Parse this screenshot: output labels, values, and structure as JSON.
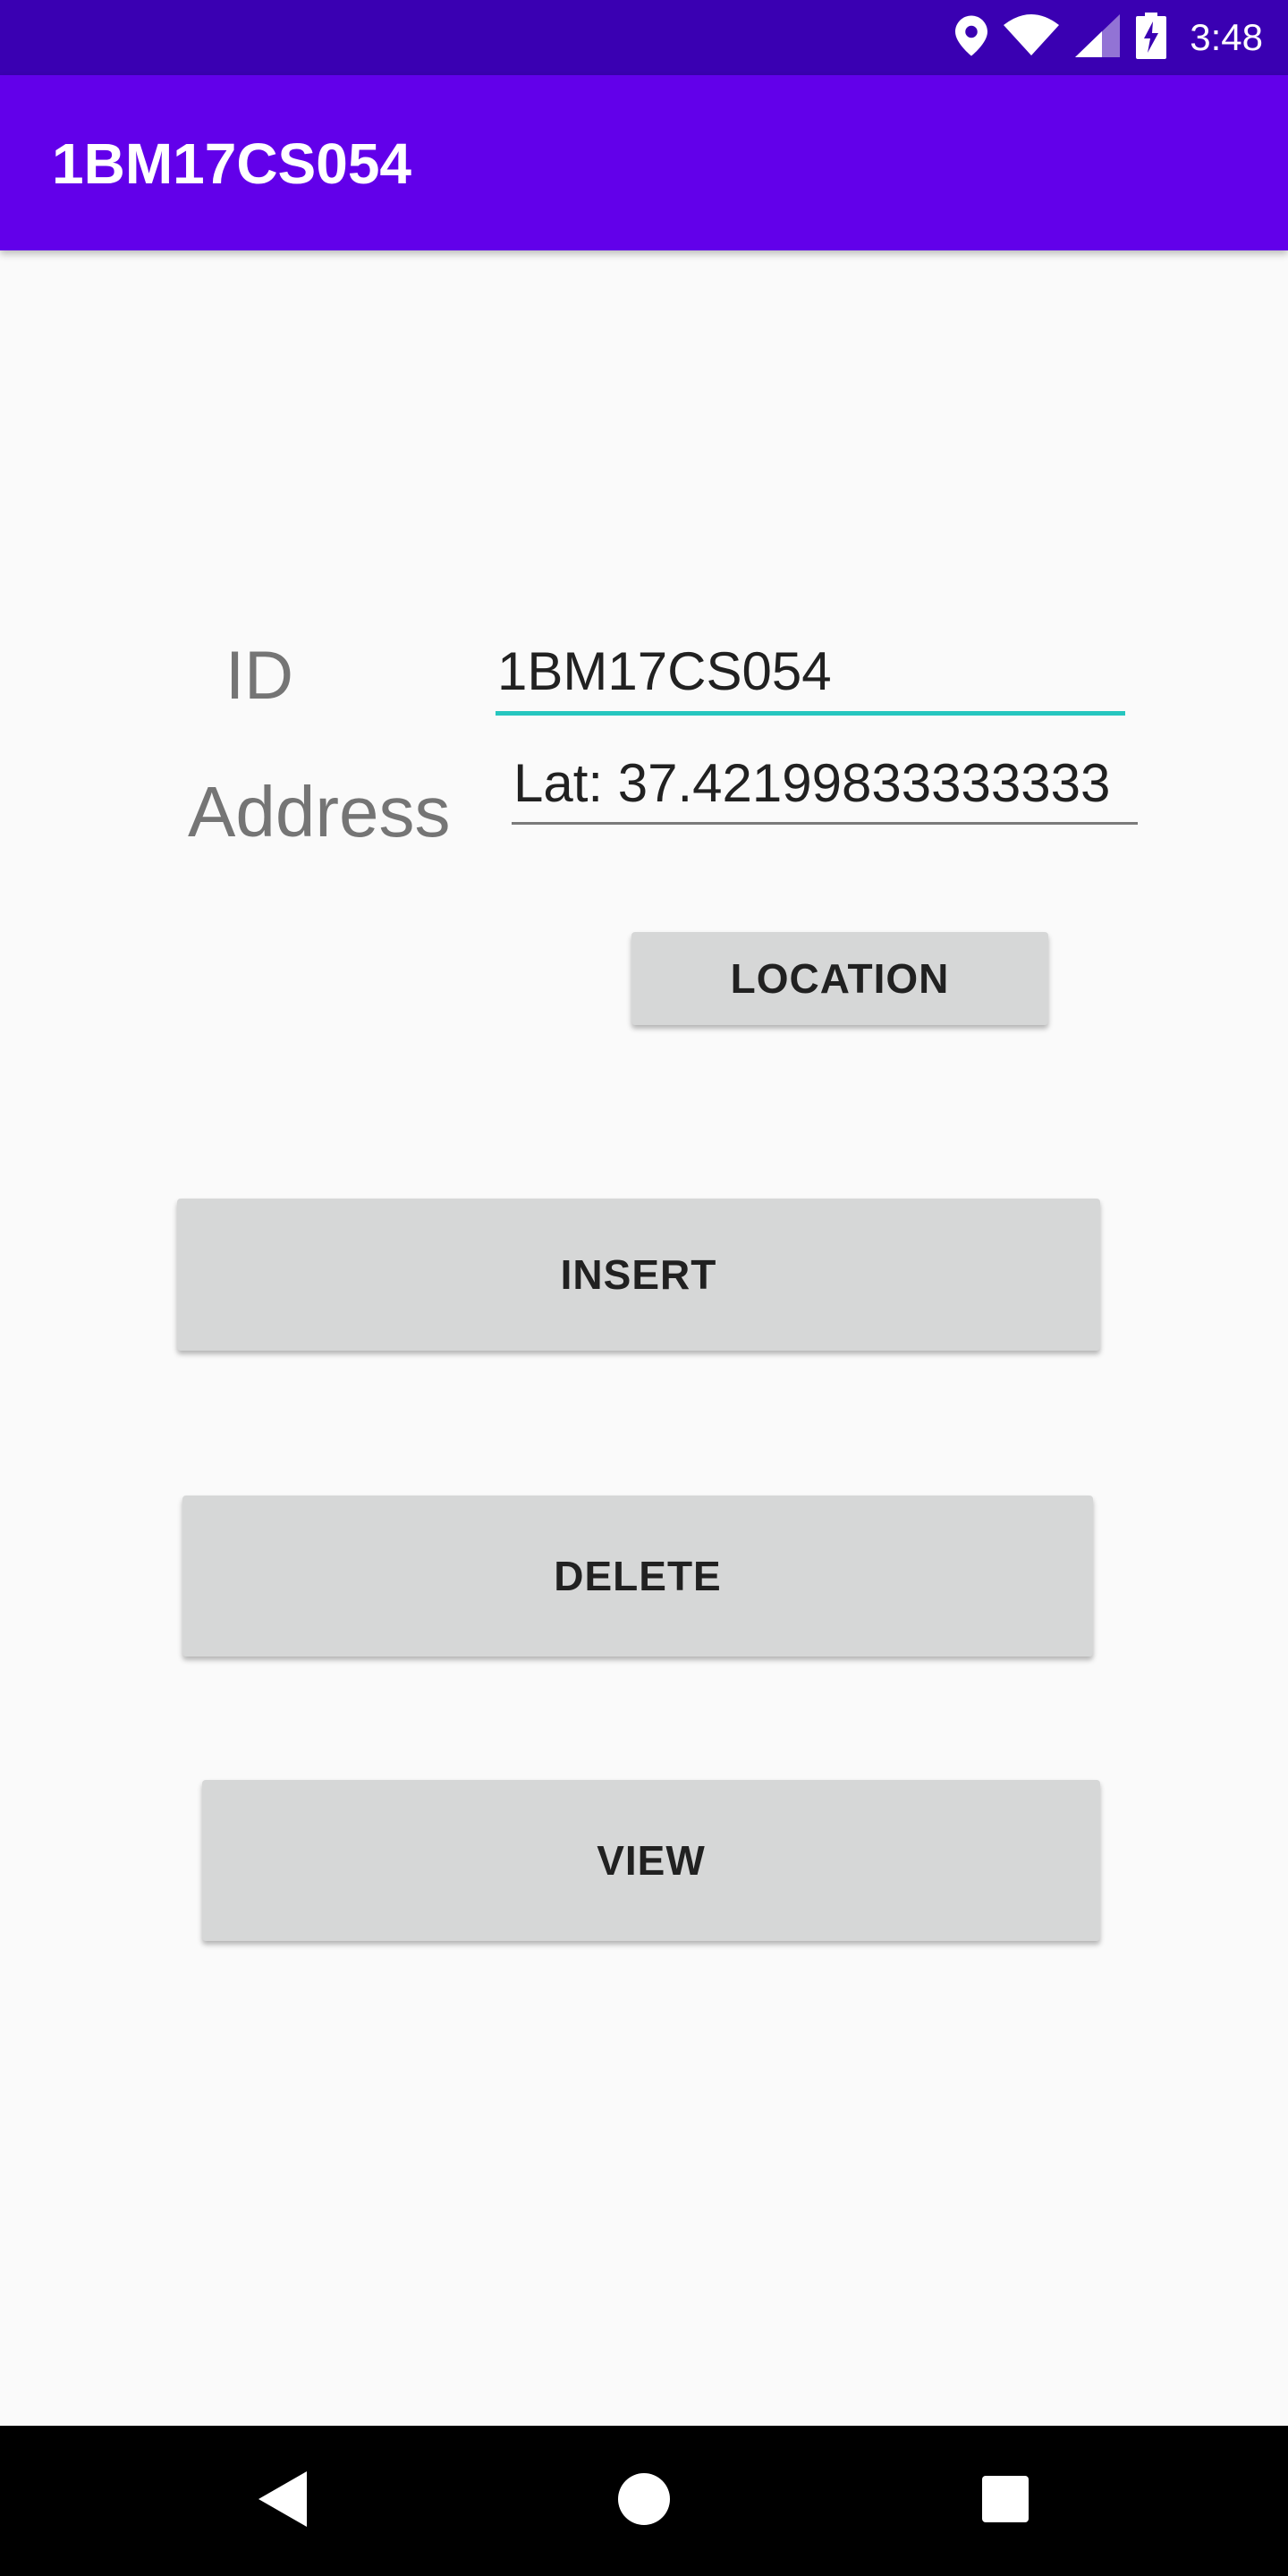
{
  "status_bar": {
    "time": "3:48",
    "icons": [
      "location-pin-icon",
      "wifi-icon",
      "cell-signal-icon",
      "battery-charging-icon"
    ]
  },
  "app_bar": {
    "title": "1BM17CS054"
  },
  "form": {
    "id_label": "ID",
    "id_value": "1BM17CS054",
    "address_label": "Address",
    "address_value": "Lat: 37.42199833333333"
  },
  "buttons": {
    "location": "LOCATION",
    "insert": "INSERT",
    "delete": "DELETE",
    "view": "VIEW"
  },
  "nav_bar": {
    "icons": [
      "back-icon",
      "home-icon",
      "recents-icon"
    ]
  },
  "colors": {
    "status_bar": "#3a00b2",
    "app_bar": "#6200ea",
    "accent_underline": "#26c6bf",
    "button_bg": "#d6d7d7"
  }
}
